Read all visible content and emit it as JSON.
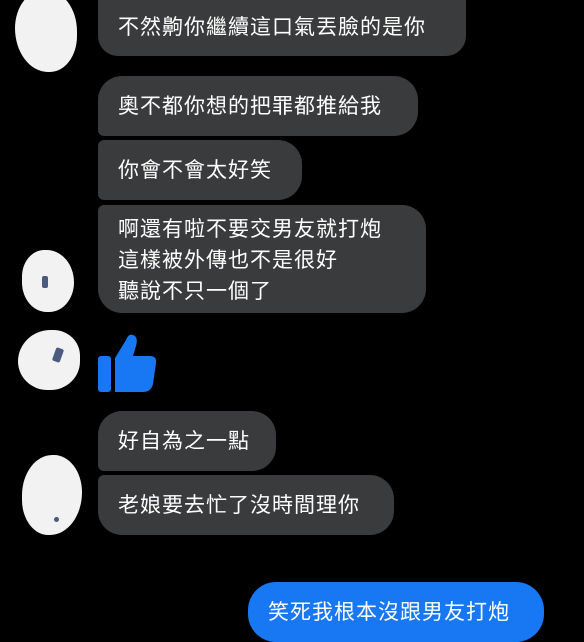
{
  "conversation": {
    "incoming": [
      {
        "lines": [
          "不然齁你繼續這口氣丟臉的是你"
        ]
      },
      {
        "lines": [
          "奧不都你想的把罪都推給我"
        ]
      },
      {
        "lines": [
          "你會不會太好笑"
        ]
      },
      {
        "lines": [
          "啊還有啦不要交男友就打炮",
          "這樣被外傳也不是很好",
          "聽說不只一個了"
        ]
      },
      {
        "lines": [
          "好自為之一點"
        ]
      },
      {
        "lines": [
          "老娘要去忙了沒時間理你"
        ]
      }
    ],
    "reaction": {
      "icon": "thumbs-up-icon",
      "color": "#1877f2"
    },
    "outgoing": [
      {
        "lines": [
          "笑死我根本沒跟男友打炮"
        ]
      }
    ]
  },
  "colors": {
    "background": "#000000",
    "incoming_bubble": "#3a3b3c",
    "outgoing_bubble": "#1877f2",
    "text": "#ffffff"
  }
}
